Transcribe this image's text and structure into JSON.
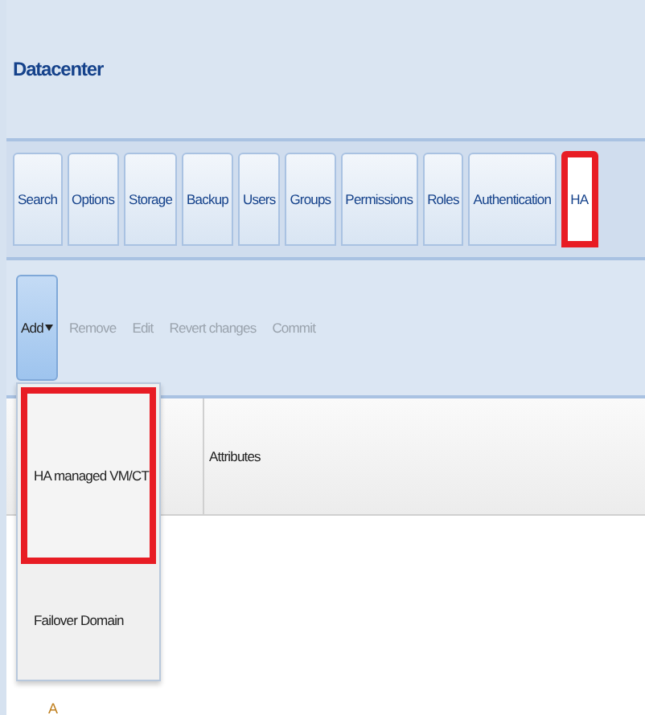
{
  "header": {
    "title": "Datacenter"
  },
  "tabs": [
    {
      "label": "Search",
      "selected": false,
      "highlighted": false
    },
    {
      "label": "Options",
      "selected": false,
      "highlighted": false
    },
    {
      "label": "Storage",
      "selected": false,
      "highlighted": false
    },
    {
      "label": "Backup",
      "selected": false,
      "highlighted": false
    },
    {
      "label": "Users",
      "selected": false,
      "highlighted": false
    },
    {
      "label": "Groups",
      "selected": false,
      "highlighted": false
    },
    {
      "label": "Permissions",
      "selected": false,
      "highlighted": false
    },
    {
      "label": "Roles",
      "selected": false,
      "highlighted": false
    },
    {
      "label": "Authentication",
      "selected": false,
      "highlighted": false
    },
    {
      "label": "HA",
      "selected": true,
      "highlighted": true
    }
  ],
  "toolbar": [
    {
      "label": "Add",
      "kind": "menu",
      "disabled": false,
      "pressed": true
    },
    {
      "label": "Remove",
      "kind": "button",
      "disabled": true,
      "pressed": false
    },
    {
      "label": "Edit",
      "kind": "button",
      "disabled": true,
      "pressed": false
    },
    {
      "label": "Revert changes",
      "kind": "button",
      "disabled": true,
      "pressed": false
    },
    {
      "label": "Commit",
      "kind": "button",
      "disabled": true,
      "pressed": false
    }
  ],
  "grid": {
    "columns": [
      "Attributes"
    ],
    "row_text": "A"
  },
  "menu": [
    {
      "label": "HA managed VM/CT",
      "highlighted": true
    },
    {
      "label": "Failover Domain",
      "highlighted": false
    }
  ]
}
